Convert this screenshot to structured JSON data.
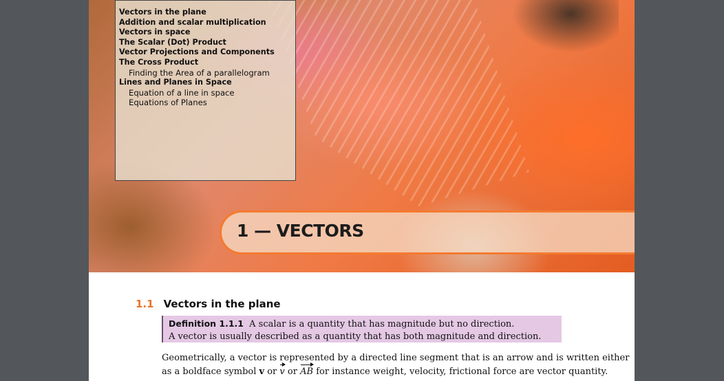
{
  "toc": {
    "items": [
      {
        "label": "Vectors in the plane",
        "level": 1
      },
      {
        "label": "Addition and scalar multiplication",
        "level": 1
      },
      {
        "label": "Vectors in space",
        "level": 1
      },
      {
        "label": "The Scalar (Dot) Product",
        "level": 1
      },
      {
        "label": "Vector Projections and Components",
        "level": 1
      },
      {
        "label": "The Cross Product",
        "level": 1
      },
      {
        "label": "Finding the Area of a parallelogram",
        "level": 2
      },
      {
        "label": "Lines and Planes in Space",
        "level": 1
      },
      {
        "label": "Equation of a line in space",
        "level": 2
      },
      {
        "label": "Equations of Planes",
        "level": 2
      }
    ]
  },
  "chapter": {
    "title": "1 — VECTORS"
  },
  "section": {
    "number": "1.1",
    "title": "Vectors in the plane"
  },
  "definition": {
    "label": "Definition 1.1.1",
    "line1": "A scalar is a quantity that has magnitude but no direction.",
    "line2": "A vector is usually described as a quantity that has both magnitude and direction."
  },
  "body": {
    "line1": "Geometrically, a vector is represented by a directed line segment that is an arrow and is written either",
    "line2_a": "as a boldface symbol",
    "line2_bold": "v",
    "line2_or1": "or",
    "line2_vec1": "v",
    "line2_or2": "or",
    "line2_vec2": "AB",
    "line2_b": "for instance weight, velocity, frictional force are vector quantity."
  },
  "colors": {
    "accent": "#e8742c",
    "definition_bg": "#e4c8e4",
    "viewer_bg": "#53575b"
  }
}
